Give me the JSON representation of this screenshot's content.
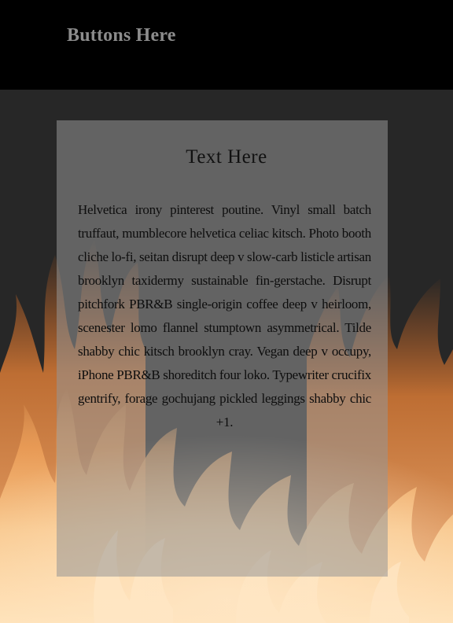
{
  "header": {
    "title": "Buttons Here"
  },
  "panel": {
    "title": "Text Here",
    "body": "Helvetica irony pinterest poutine. Vinyl small batch truffaut, mumblecore helvetica celiac kitsch. Photo booth cliche lo-fi, seitan disrupt deep v slow-carb listicle artisan brooklyn taxidermy sustainable fin-gerstache. Disrupt pitchfork PBR&B single-origin coffee deep v heirloom, scenester lomo flannel stumptown asymmetrical. Tilde shabby chic kitsch brooklyn cray. Vegan deep v occupy, iPhone PBR&B shoreditch four loko. Typewriter crucifix gentrify, forage gochujang pickled leggings shabby chic +1."
  },
  "background": {
    "image": "fire-flames-icon"
  },
  "colors": {
    "header_bg": "#000000",
    "page_bg": "#272727",
    "header_text": "#8c8c8c",
    "flame_orange": "#e8843a",
    "flame_light": "#ffd9a0"
  }
}
